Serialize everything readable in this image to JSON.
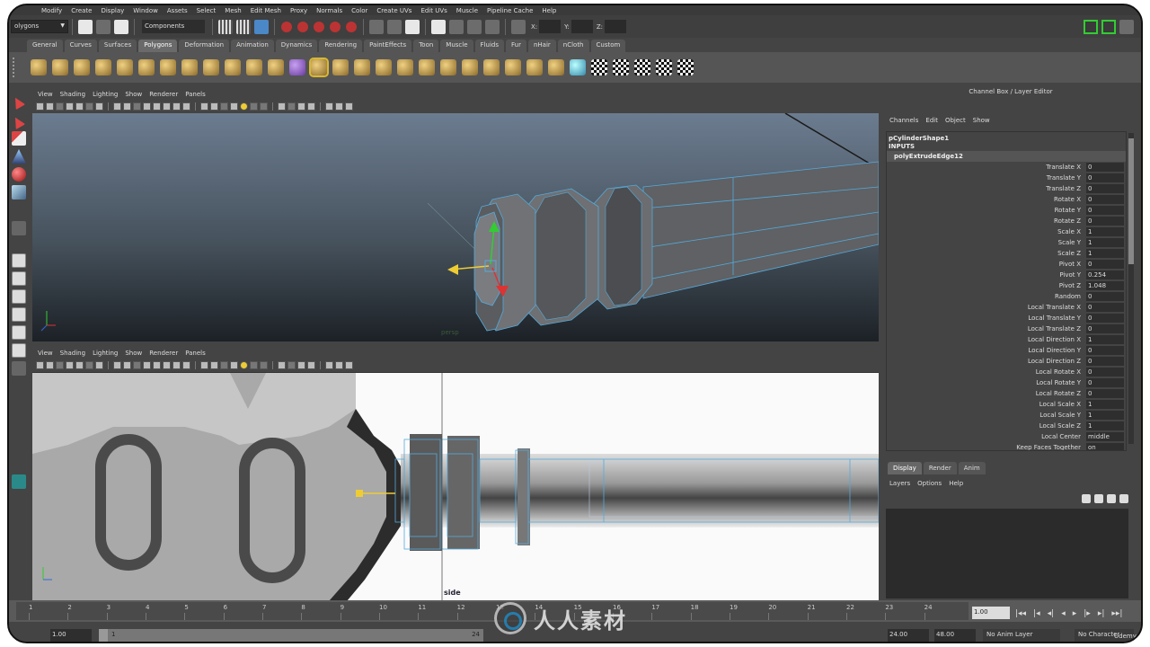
{
  "menubar": [
    "Modify",
    "Create",
    "Display",
    "Window",
    "Assets",
    "Select",
    "Mesh",
    "Edit Mesh",
    "Proxy",
    "Normals",
    "Color",
    "Create UVs",
    "Edit UVs",
    "Muscle",
    "Pipeline Cache",
    "Help"
  ],
  "statusline": {
    "mode": "olygons",
    "components_label": "Components",
    "x_label": "X:",
    "y_label": "Y:",
    "z_label": "Z:"
  },
  "shelf_tabs": [
    "General",
    "Curves",
    "Surfaces",
    "Polygons",
    "Deformation",
    "Animation",
    "Dynamics",
    "Rendering",
    "PaintEffects",
    "Toon",
    "Muscle",
    "Fluids",
    "Fur",
    "nHair",
    "nCloth",
    "Custom"
  ],
  "shelf_active_tab": "Polygons",
  "panel_menu": [
    "View",
    "Shading",
    "Lighting",
    "Show",
    "Renderer",
    "Panels"
  ],
  "viewport_top": {
    "camera": "persp"
  },
  "viewport_bottom": {
    "camera": "side"
  },
  "channel_box": {
    "title": "Channel Box / Layer Editor",
    "menu": [
      "Channels",
      "Edit",
      "Object",
      "Show"
    ],
    "object": "pCylinderShape1",
    "inputs_label": "INPUTS",
    "node": "polyExtrudeEdge12",
    "attributes": [
      {
        "name": "Translate X",
        "value": "0"
      },
      {
        "name": "Translate Y",
        "value": "0"
      },
      {
        "name": "Translate Z",
        "value": "0"
      },
      {
        "name": "Rotate X",
        "value": "0"
      },
      {
        "name": "Rotate Y",
        "value": "0"
      },
      {
        "name": "Rotate Z",
        "value": "0"
      },
      {
        "name": "Scale X",
        "value": "1"
      },
      {
        "name": "Scale Y",
        "value": "1"
      },
      {
        "name": "Scale Z",
        "value": "1"
      },
      {
        "name": "Pivot X",
        "value": "0"
      },
      {
        "name": "Pivot Y",
        "value": "0.254"
      },
      {
        "name": "Pivot Z",
        "value": "1.048"
      },
      {
        "name": "Random",
        "value": "0"
      },
      {
        "name": "Local Translate X",
        "value": "0"
      },
      {
        "name": "Local Translate Y",
        "value": "0"
      },
      {
        "name": "Local Translate Z",
        "value": "0"
      },
      {
        "name": "Local Direction X",
        "value": "1"
      },
      {
        "name": "Local Direction Y",
        "value": "0"
      },
      {
        "name": "Local Direction Z",
        "value": "0"
      },
      {
        "name": "Local Rotate X",
        "value": "0"
      },
      {
        "name": "Local Rotate Y",
        "value": "0"
      },
      {
        "name": "Local Rotate Z",
        "value": "0"
      },
      {
        "name": "Local Scale X",
        "value": "1"
      },
      {
        "name": "Local Scale Y",
        "value": "1"
      },
      {
        "name": "Local Scale Z",
        "value": "1"
      },
      {
        "name": "Local Center",
        "value": "middle"
      },
      {
        "name": "Keep Faces Together",
        "value": "on"
      }
    ]
  },
  "layer_editor": {
    "tabs": [
      "Display",
      "Render",
      "Anim"
    ],
    "active_tab": "Display",
    "menu": [
      "Layers",
      "Options",
      "Help"
    ]
  },
  "timeline": {
    "ticks": [
      "1",
      "2",
      "3",
      "4",
      "5",
      "6",
      "7",
      "8",
      "9",
      "10",
      "11",
      "12",
      "13",
      "14",
      "15",
      "16",
      "17",
      "18",
      "19",
      "20",
      "21",
      "22",
      "23",
      "24"
    ],
    "current_frame": "1.00",
    "playback": [
      "|◂◂",
      "|◂",
      "◂|",
      "◂",
      "▸",
      "|▸",
      "▸|",
      "▸▸|"
    ]
  },
  "range": {
    "start": "1.00",
    "inner_start": "1",
    "inner_end": "24",
    "end": "24.00",
    "max": "48.00",
    "anim_layer": "No Anim Layer",
    "character": "No Character"
  },
  "watermark": {
    "text": "人人素材",
    "brand": "Udemy"
  }
}
